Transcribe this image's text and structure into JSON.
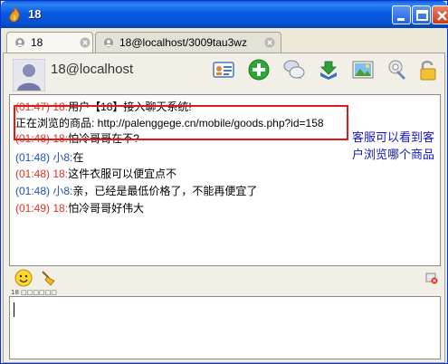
{
  "window": {
    "title": "18"
  },
  "tabs": [
    {
      "label": "18",
      "active": true
    },
    {
      "label": "18@localhost/3009tau3wz",
      "active": false
    }
  ],
  "contact": {
    "name": "18@localhost"
  },
  "toolbar": {
    "icons": [
      "contact-card-icon",
      "add-icon",
      "chat-bubbles-icon",
      "download-icon",
      "image-icon",
      "settings-wrench-icon",
      "lock-icon"
    ]
  },
  "messages": [
    {
      "time": "(01:47)",
      "sender": "18:",
      "text": "用户【18】接入聊天系统!",
      "color": "red"
    },
    {
      "time": "",
      "sender": "",
      "text": "正在浏览的商品: http://palenggege.cn/mobile/goods.php?id=158",
      "color": "plain"
    },
    {
      "time": "(01:48)",
      "sender": "18:",
      "text": "怕冷哥哥在不?",
      "color": "red"
    },
    {
      "time": "(01:48)",
      "sender": "小8:",
      "text": "在",
      "color": "blue"
    },
    {
      "time": "(01:48)",
      "sender": "18:",
      "text": "这件衣服可以便宜点不",
      "color": "red"
    },
    {
      "time": "(01:48)",
      "sender": "小8:",
      "text": "亲，已经是最低价格了，不能再便宜了",
      "color": "blue"
    },
    {
      "time": "(01:49)",
      "sender": "18:",
      "text": "怕冷哥哥好伟大",
      "color": "red"
    }
  ],
  "annotation": {
    "text": "客服可以看到客户浏览哪个商品"
  },
  "status": {
    "text": "18 □□□□□□"
  },
  "colors": {
    "title_bar": "#0A59E3",
    "red_sender": "#E03020",
    "blue_sender": "#2050C0",
    "annotation": "#1515D0",
    "highlight": "#E01818"
  }
}
